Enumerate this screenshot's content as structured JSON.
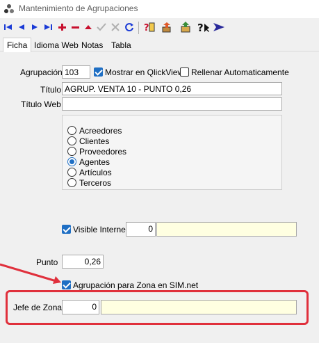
{
  "window": {
    "title": "Mantenimiento de Agrupaciones"
  },
  "toolbar": {
    "icons": [
      "first-record-icon",
      "prev-record-icon",
      "next-record-icon",
      "last-record-icon",
      "add-icon",
      "delete-icon",
      "up-icon",
      "confirm-icon",
      "cancel-icon",
      "refresh-icon",
      "help-doc-icon",
      "export-icon",
      "context-help-icon",
      "exit-icon"
    ]
  },
  "tabs": [
    {
      "label": "Ficha",
      "active": true
    },
    {
      "label": "Idioma Web"
    },
    {
      "label": "Notas"
    },
    {
      "label": "Tabla"
    }
  ],
  "form": {
    "agrupacion_label": "Agrupación",
    "agrupacion_value": "103",
    "mostrar_qlikview_label": "Mostrar en QlickView",
    "mostrar_qlikview_checked": true,
    "rellenar_auto_label": "Rellenar Automaticamente",
    "rellenar_auto_checked": false,
    "titulo_label": "Título",
    "titulo_value": "AGRUP. VENTA 10 - PUNTO 0,26",
    "titulo_web_label": "Título Web",
    "titulo_web_value": "",
    "radio_options": [
      {
        "label": "Acreedores",
        "checked": false
      },
      {
        "label": "Clientes",
        "checked": false
      },
      {
        "label": "Proveedores",
        "checked": false
      },
      {
        "label": "Agentes",
        "checked": true
      },
      {
        "label": "Artículos",
        "checked": false
      },
      {
        "label": "Terceros",
        "checked": false
      }
    ],
    "visible_internet_label": "Visible Internet",
    "visible_internet_checked": true,
    "visible_internet_value": "0",
    "visible_internet_desc": "",
    "punto_label": "Punto",
    "punto_value": "0,26",
    "zona_sim_label": "Agrupación para Zona en SIM.net",
    "zona_sim_checked": true,
    "jefe_zona_label": "Jefe de Zona",
    "jefe_zona_value": "0",
    "jefe_zona_desc": ""
  },
  "colors": {
    "accent": "#1f6fc4",
    "highlight": "#e0303c",
    "field_yellow": "#ffffe1"
  }
}
